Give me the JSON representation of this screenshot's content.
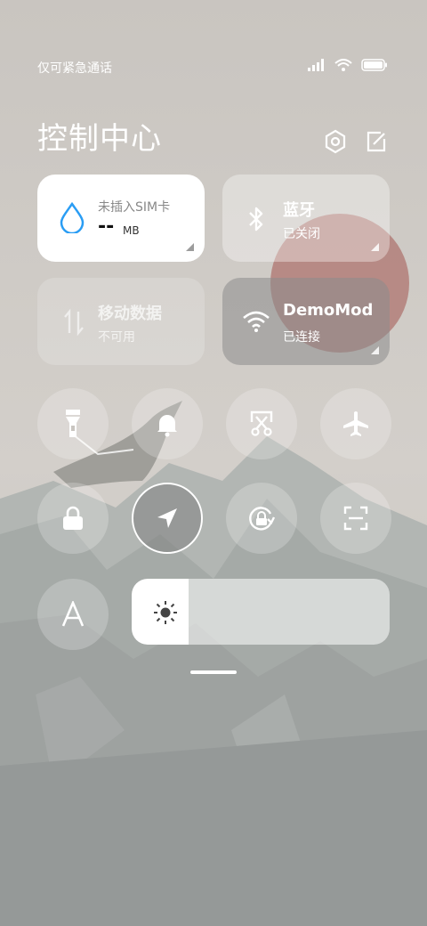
{
  "status_bar": {
    "carrier_text": "仅可紧急通话",
    "icons": [
      "signal-icon",
      "wifi-icon",
      "battery-icon"
    ]
  },
  "header": {
    "title": "控制中心",
    "icons": [
      "settings-hexagon-icon",
      "edit-icon"
    ]
  },
  "tiles": {
    "data_usage": {
      "title": "未插入SIM卡",
      "value": "--",
      "unit": "MB",
      "icon": "water-drop-icon",
      "accent": "#2a9df4"
    },
    "bluetooth": {
      "title": "蓝牙",
      "status": "已关闭",
      "icon": "bluetooth-icon"
    },
    "mobile_data": {
      "title": "移动数据",
      "status": "不可用",
      "icon": "mobile-data-icon"
    },
    "wifi": {
      "title": "DemoMod",
      "status": "已连接",
      "icon": "wifi-icon"
    }
  },
  "toggles": [
    {
      "name": "flashlight",
      "icon": "flashlight-icon",
      "active": false
    },
    {
      "name": "mute",
      "icon": "bell-icon",
      "active": false
    },
    {
      "name": "screenshot",
      "icon": "screenshot-scissors-icon",
      "active": false
    },
    {
      "name": "airplane",
      "icon": "airplane-icon",
      "active": false
    },
    {
      "name": "lock",
      "icon": "lock-icon",
      "active": false
    },
    {
      "name": "location",
      "icon": "location-arrow-icon",
      "active": true
    },
    {
      "name": "auto-rotate",
      "icon": "rotation-lock-icon",
      "active": false
    },
    {
      "name": "scanner",
      "icon": "scan-icon",
      "active": false
    },
    {
      "name": "font",
      "icon": "font-a-icon",
      "active": false
    }
  ],
  "brightness": {
    "level": 0.22,
    "icon": "sun-icon"
  }
}
